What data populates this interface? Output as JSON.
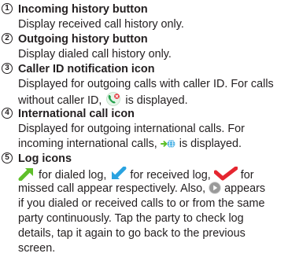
{
  "items": [
    {
      "number": "1",
      "title": "Incoming history button",
      "lines": [
        "Display received call history only."
      ]
    },
    {
      "number": "2",
      "title": "Outgoing history button",
      "lines": [
        "Display dialed call history only."
      ]
    },
    {
      "number": "3",
      "title": "Caller ID notification icon",
      "line1": "Displayed for outgoing calls with caller ID. For calls",
      "line2_before": "without caller ID,",
      "line2_after": "is displayed."
    },
    {
      "number": "4",
      "title": "International call icon",
      "line1": "Displayed for outgoing international calls. For",
      "line2_before": "incoming international calls,",
      "line2_after": "is displayed."
    },
    {
      "number": "5",
      "title": "Log icons",
      "line1_a": "for dialed log,",
      "line1_b": "for received log,",
      "line1_c": "for",
      "line2_a": "missed call appear respectively. Also,",
      "line2_b": "appears",
      "line3": "if you dialed or received calls to or from the same",
      "line4": "party continuously. Tap the party to check log",
      "line5": "details, tap it again to go back to the previous",
      "line6": "screen."
    }
  ],
  "icons": {
    "no_caller_id": "phone-no-caller-id-icon",
    "incoming_international": "incoming-international-icon",
    "dialed_log": "dialed-log-arrow-icon",
    "received_log": "received-log-arrow-icon",
    "missed_log": "missed-call-check-icon",
    "continuous": "continuous-call-play-icon"
  },
  "colors": {
    "text": "#231f20",
    "dialed_green": "#5fbf2a",
    "received_blue": "#2aa3e0",
    "missed_red": "#e52630",
    "continuous_gray": "#9a9a9a"
  }
}
